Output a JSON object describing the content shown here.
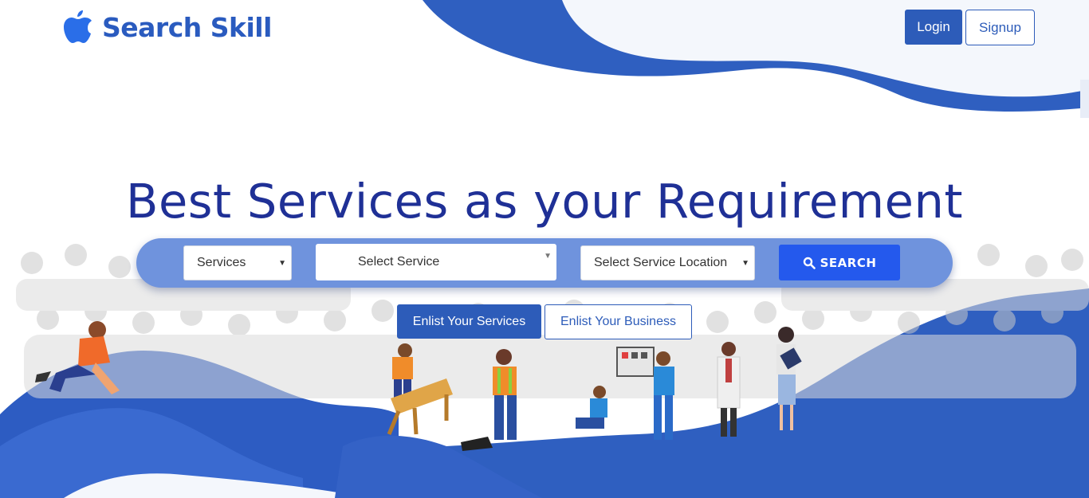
{
  "brand": {
    "name": "Search Skill",
    "color": "#2a5bbf",
    "icon": "apple-icon"
  },
  "header": {
    "login_label": "Login",
    "signup_label": "Signup"
  },
  "hero": {
    "title": "Best Services as your Requirement"
  },
  "search": {
    "category_value": "Services",
    "service_placeholder": "Select Service",
    "location_placeholder": "Select Service Location",
    "button_label": "SEARCH",
    "button_icon": "search-icon"
  },
  "enlist": {
    "services_label": "Enlist Your Services",
    "business_label": "Enlist Your Business"
  },
  "colors": {
    "primary": "#2d5cb9",
    "title": "#1f3096",
    "search_bar": "#6f93dd",
    "search_button": "#2459ed",
    "wave": "#2f5fc0"
  }
}
